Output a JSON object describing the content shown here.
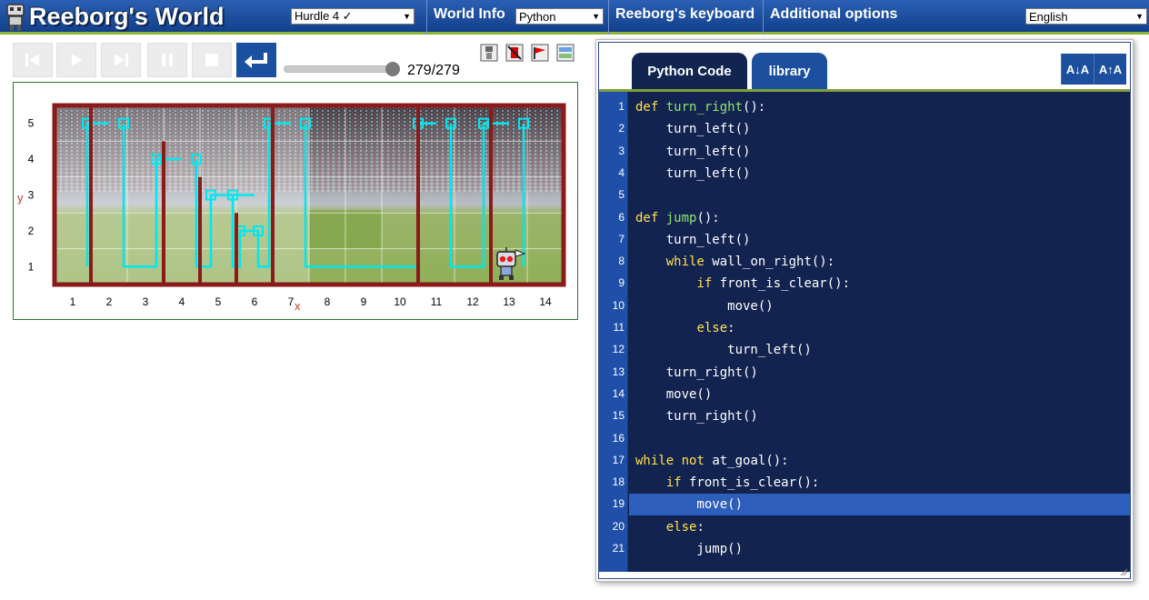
{
  "header": {
    "app_title": "Reeborg's World",
    "world_select": "Hurdle 4 ✓",
    "world_info_label": "World Info",
    "language_select": "Python",
    "keyboard_label": "Reeborg's keyboard",
    "additional_options_label": "Additional options",
    "ui_language_select": "English"
  },
  "controls": {
    "buttons": [
      "reverse-step",
      "run",
      "step",
      "pause",
      "stop",
      "reload"
    ],
    "step_current": "279",
    "step_separator": "/",
    "step_total": "279",
    "slider_fraction": 1.0
  },
  "world": {
    "y_axis_label": "y",
    "x_axis_label": "x",
    "x_ticks": [
      "1",
      "2",
      "3",
      "4",
      "5",
      "6",
      "7",
      "8",
      "9",
      "10",
      "11",
      "12",
      "13",
      "14"
    ],
    "y_ticks": [
      "1",
      "2",
      "3",
      "4",
      "5"
    ],
    "wall_color": "#8b1a1a",
    "trace_color": "#00e8ee",
    "robot_position": [
      13,
      1
    ]
  },
  "editor": {
    "tabs": [
      "Python Code",
      "library"
    ],
    "active_tab": "Python Code",
    "font_decrease_label": "A↓A",
    "font_increase_label": "A↑A",
    "active_line": 19,
    "lines": [
      [
        [
          "kw",
          "def"
        ],
        [
          "pn",
          " "
        ],
        [
          "fn",
          "turn_right"
        ],
        [
          "pn",
          "():"
        ]
      ],
      [
        [
          "pn",
          "    turn_left()"
        ]
      ],
      [
        [
          "pn",
          "    turn_left()"
        ]
      ],
      [
        [
          "pn",
          "    turn_left()"
        ]
      ],
      [
        [
          "pn",
          ""
        ]
      ],
      [
        [
          "kw",
          "def"
        ],
        [
          "pn",
          " "
        ],
        [
          "fn",
          "jump"
        ],
        [
          "pn",
          "():"
        ]
      ],
      [
        [
          "pn",
          "    turn_left()"
        ]
      ],
      [
        [
          "pn",
          "    "
        ],
        [
          "kw",
          "while"
        ],
        [
          "pn",
          " wall_on_right():"
        ]
      ],
      [
        [
          "pn",
          "        "
        ],
        [
          "kw",
          "if"
        ],
        [
          "pn",
          " front_is_clear():"
        ]
      ],
      [
        [
          "pn",
          "            move()"
        ]
      ],
      [
        [
          "pn",
          "        "
        ],
        [
          "kw",
          "else"
        ],
        [
          "pn",
          ":"
        ]
      ],
      [
        [
          "pn",
          "            turn_left()"
        ]
      ],
      [
        [
          "pn",
          "    turn_right()"
        ]
      ],
      [
        [
          "pn",
          "    move()"
        ]
      ],
      [
        [
          "pn",
          "    turn_right()"
        ]
      ],
      [
        [
          "pn",
          ""
        ]
      ],
      [
        [
          "kw",
          "while"
        ],
        [
          "pn",
          " "
        ],
        [
          "kw",
          "not"
        ],
        [
          "pn",
          " at_goal():"
        ]
      ],
      [
        [
          "pn",
          "    "
        ],
        [
          "kw",
          "if"
        ],
        [
          "pn",
          " front_is_clear():"
        ]
      ],
      [
        [
          "pn",
          "        move()"
        ]
      ],
      [
        [
          "pn",
          "    "
        ],
        [
          "kw",
          "else"
        ],
        [
          "pn",
          ":"
        ]
      ],
      [
        [
          "pn",
          "        jump()"
        ]
      ]
    ]
  }
}
